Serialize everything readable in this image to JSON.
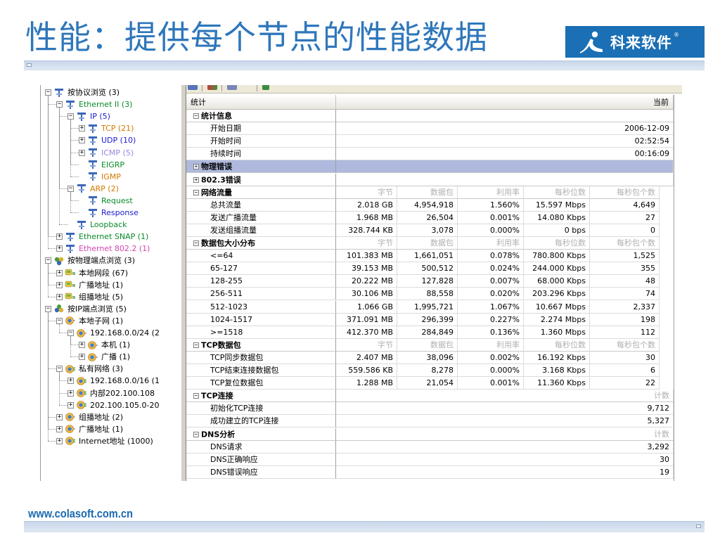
{
  "slide": {
    "title": "性能：提供每个节点的性能数据",
    "logo_text": "科来软件",
    "logo_reg": "®",
    "footer_url": "www.colasoft.com.cn"
  },
  "colors": {
    "title": "#2f77bb",
    "logo_bg": "#1b6fb4",
    "section_highlight": "#aeb9dd",
    "green_text": "#0a8a2a",
    "blue_text": "#1a1ad0",
    "orange_text": "#d17a00",
    "violet_text": "#9a85e0",
    "magenta_text": "#d245b0"
  },
  "tree": [
    {
      "depth": 0,
      "toggle": "−",
      "icon": "protocol-icon",
      "label": "按协议浏览 (3)",
      "color": "#000000"
    },
    {
      "depth": 1,
      "toggle": "−",
      "icon": "protocol-icon",
      "label": "Ethernet II (3)",
      "color": "#0a8a2a"
    },
    {
      "depth": 2,
      "toggle": "−",
      "icon": "protocol-icon",
      "label": "IP (5)",
      "color": "#1a1ad0"
    },
    {
      "depth": 3,
      "toggle": "+",
      "icon": "protocol-icon",
      "label": "TCP (21)",
      "color": "#d17a00"
    },
    {
      "depth": 3,
      "toggle": "+",
      "icon": "protocol-icon",
      "label": "UDP (10)",
      "color": "#1a1ad0"
    },
    {
      "depth": 3,
      "toggle": "+",
      "icon": "protocol-icon",
      "label": "ICMP (5)",
      "color": "#9a85e0"
    },
    {
      "depth": 3,
      "toggle": "",
      "icon": "protocol-icon",
      "label": "EIGRP",
      "color": "#0a8a2a"
    },
    {
      "depth": 3,
      "toggle": "",
      "icon": "protocol-icon",
      "label": "IGMP",
      "color": "#d17a00"
    },
    {
      "depth": 2,
      "toggle": "−",
      "icon": "protocol-icon",
      "label": "ARP (2)",
      "color": "#d17a00"
    },
    {
      "depth": 3,
      "toggle": "",
      "icon": "protocol-icon",
      "label": "Request",
      "color": "#0a8a2a"
    },
    {
      "depth": 3,
      "toggle": "",
      "icon": "protocol-icon",
      "label": "Response",
      "color": "#1a1ad0"
    },
    {
      "depth": 2,
      "toggle": "",
      "icon": "protocol-icon",
      "label": "Loopback",
      "color": "#0a8a2a"
    },
    {
      "depth": 1,
      "toggle": "+",
      "icon": "protocol-icon",
      "label": "Ethernet SNAP (1)",
      "color": "#0a8a2a"
    },
    {
      "depth": 1,
      "toggle": "+",
      "icon": "protocol-icon",
      "label": "Ethernet 802.2 (1)",
      "color": "#d245b0"
    },
    {
      "depth": 0,
      "toggle": "−",
      "icon": "physical-endpoint-icon",
      "label": "按物理端点浏览 (3)",
      "color": "#000000"
    },
    {
      "depth": 1,
      "toggle": "+",
      "icon": "segment-icon",
      "label": "本地网段 (67)",
      "color": "#000000"
    },
    {
      "depth": 1,
      "toggle": "+",
      "icon": "segment-icon",
      "label": "广播地址 (1)",
      "color": "#000000"
    },
    {
      "depth": 1,
      "toggle": "+",
      "icon": "segment-icon",
      "label": "组播地址 (5)",
      "color": "#000000"
    },
    {
      "depth": 0,
      "toggle": "−",
      "icon": "ip-endpoint-icon",
      "label": "按IP端点浏览 (5)",
      "color": "#000000"
    },
    {
      "depth": 1,
      "toggle": "−",
      "icon": "subnet-icon",
      "label": "本地子网 (1)",
      "color": "#000000"
    },
    {
      "depth": 2,
      "toggle": "−",
      "icon": "subnet-icon",
      "label": "192.168.0.0/24 (2",
      "color": "#000000"
    },
    {
      "depth": 3,
      "toggle": "+",
      "icon": "subnet-icon",
      "label": "本机 (1)",
      "color": "#000000"
    },
    {
      "depth": 3,
      "toggle": "+",
      "icon": "subnet-icon",
      "label": "广播 (1)",
      "color": "#000000"
    },
    {
      "depth": 1,
      "toggle": "−",
      "icon": "private-network-icon",
      "label": "私有网络 (3)",
      "color": "#000000"
    },
    {
      "depth": 2,
      "toggle": "+",
      "icon": "private-network-icon",
      "label": "192.168.0.0/16 (1",
      "color": "#000000"
    },
    {
      "depth": 2,
      "toggle": "+",
      "icon": "private-network-icon",
      "label": "内部202.100.108",
      "color": "#000000"
    },
    {
      "depth": 2,
      "toggle": "+",
      "icon": "private-network-icon",
      "label": "202.100.105.0-20",
      "color": "#000000"
    },
    {
      "depth": 1,
      "toggle": "+",
      "icon": "subnet-icon",
      "label": "组播地址 (2)",
      "color": "#000000"
    },
    {
      "depth": 1,
      "toggle": "+",
      "icon": "subnet-icon",
      "label": "广播地址 (1)",
      "color": "#000000"
    },
    {
      "depth": 1,
      "toggle": "+",
      "icon": "private-network-icon",
      "label": "Internet地址 (1000)",
      "color": "#000000"
    }
  ],
  "grid": {
    "col_stats": "统计",
    "col_current": "当前",
    "rows": [
      {
        "kind": "section",
        "toggle": "−",
        "title": "统计信息"
      },
      {
        "kind": "span",
        "name": "开始日期",
        "value": "2006-12-09"
      },
      {
        "kind": "span",
        "name": "开始时间",
        "value": "02:52:54"
      },
      {
        "kind": "span",
        "name": "持续时间",
        "value": "00:16:09"
      },
      {
        "kind": "section",
        "toggle": "+",
        "title": "物理错误",
        "highlight": true
      },
      {
        "kind": "section",
        "toggle": "+",
        "title": "802.3错误"
      },
      {
        "kind": "section",
        "toggle": "−",
        "title": "网络流量",
        "headers": [
          "字节",
          "数据包",
          "利用率",
          "每秒位数",
          "每秒包个数"
        ]
      },
      {
        "kind": "cells",
        "name": "总共流量",
        "cells": [
          "2.018 GB",
          "4,954,918",
          "1.560%",
          "15.597 Mbps",
          "4,649"
        ]
      },
      {
        "kind": "cells",
        "name": "发送广播流量",
        "cells": [
          "1.968 MB",
          "26,504",
          "0.001%",
          "14.080 Kbps",
          "27"
        ]
      },
      {
        "kind": "cells",
        "name": "发送组播流量",
        "cells": [
          "328.744 KB",
          "3,078",
          "0.000%",
          "0 bps",
          "0"
        ]
      },
      {
        "kind": "section",
        "toggle": "−",
        "title": "数据包大小分布",
        "headers": [
          "字节",
          "数据包",
          "利用率",
          "每秒位数",
          "每秒包个数"
        ]
      },
      {
        "kind": "cells",
        "name": "<=64",
        "cells": [
          "101.383 MB",
          "1,661,051",
          "0.078%",
          "780.800 Kbps",
          "1,525"
        ]
      },
      {
        "kind": "cells",
        "name": "65-127",
        "cells": [
          "39.153 MB",
          "500,512",
          "0.024%",
          "244.000 Kbps",
          "355"
        ]
      },
      {
        "kind": "cells",
        "name": "128-255",
        "cells": [
          "20.222 MB",
          "127,828",
          "0.007%",
          "68.000 Kbps",
          "48"
        ]
      },
      {
        "kind": "cells",
        "name": "256-511",
        "cells": [
          "30.106 MB",
          "88,558",
          "0.020%",
          "203.296 Kbps",
          "74"
        ]
      },
      {
        "kind": "cells",
        "name": "512-1023",
        "cells": [
          "1.066 GB",
          "1,995,721",
          "1.067%",
          "10.667 Mbps",
          "2,337"
        ]
      },
      {
        "kind": "cells",
        "name": "1024-1517",
        "cells": [
          "371.091 MB",
          "296,399",
          "0.227%",
          "2.274 Mbps",
          "198"
        ]
      },
      {
        "kind": "cells",
        "name": ">=1518",
        "cells": [
          "412.370 MB",
          "284,849",
          "0.136%",
          "1.360 Mbps",
          "112"
        ]
      },
      {
        "kind": "section",
        "toggle": "−",
        "title": "TCP数据包",
        "headers": [
          "字节",
          "数据包",
          "利用率",
          "每秒位数",
          "每秒包个数"
        ]
      },
      {
        "kind": "cells",
        "name": "TCP同步数据包",
        "cells": [
          "2.407 MB",
          "38,096",
          "0.002%",
          "16.192 Kbps",
          "30"
        ]
      },
      {
        "kind": "cells",
        "name": "TCP结束连接数据包",
        "cells": [
          "559.586 KB",
          "8,278",
          "0.000%",
          "3.168 Kbps",
          "6"
        ]
      },
      {
        "kind": "cells",
        "name": "TCP复位数据包",
        "cells": [
          "1.288 MB",
          "21,054",
          "0.001%",
          "11.360 Kbps",
          "22"
        ]
      },
      {
        "kind": "section",
        "toggle": "−",
        "title": "TCP连接",
        "span_header": "计数"
      },
      {
        "kind": "span",
        "name": "初始化TCP连接",
        "value": "9,712"
      },
      {
        "kind": "span",
        "name": "成功建立的TCP连接",
        "value": "5,327"
      },
      {
        "kind": "section",
        "toggle": "−",
        "title": "DNS分析",
        "span_header": "计数"
      },
      {
        "kind": "span",
        "name": "DNS请求",
        "value": "3,292"
      },
      {
        "kind": "span",
        "name": "DNS正确响应",
        "value": "30"
      },
      {
        "kind": "span",
        "name": "DNS错误响应",
        "value": "19"
      }
    ]
  }
}
